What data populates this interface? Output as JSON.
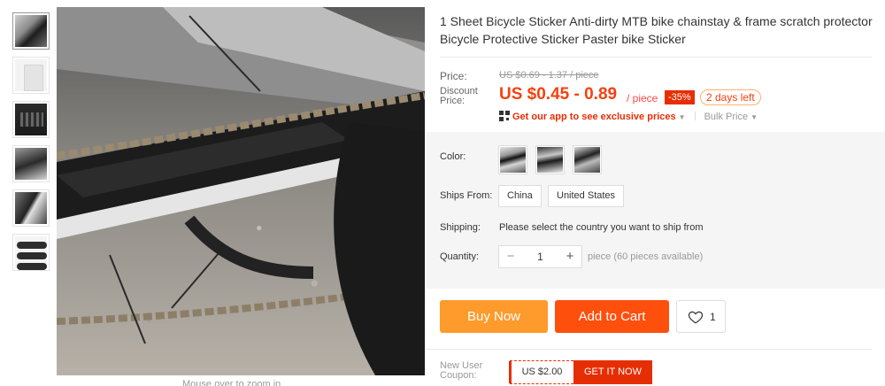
{
  "product": {
    "title": "1 Sheet Bicycle Sticker Anti-dirty MTB bike chainstay & frame scratch protector Bicycle Protective Sticker Paster bike Sticker"
  },
  "gallery": {
    "thumbnails": [
      "thumbnail-1",
      "thumbnail-2",
      "thumbnail-3",
      "thumbnail-4",
      "thumbnail-5",
      "thumbnail-6"
    ],
    "zoom_hint": "Mouse over to zoom in"
  },
  "price": {
    "label": "Price:",
    "original": "US $0.69 - 1.37 / piece",
    "discount_label": "Discount Price:",
    "current": "US $0.45 - 0.89",
    "unit": "/ piece",
    "discount_badge": "-35%",
    "time_left": "2 days left",
    "app_promo": "Get our app to see exclusive prices",
    "bulk_price": "Bulk Price"
  },
  "sku": {
    "color_label": "Color:",
    "ships_from_label": "Ships From:",
    "ships_from_options": [
      "China",
      "United States"
    ],
    "shipping_label": "Shipping:",
    "shipping_message": "Please select the country you want to ship from",
    "quantity_label": "Quantity:",
    "quantity_value": "1",
    "quantity_minus": "−",
    "quantity_plus": "+",
    "availability": "piece (60 pieces available)"
  },
  "actions": {
    "buy_now": "Buy Now",
    "add_to_cart": "Add to Cart",
    "wishlist_count": "1"
  },
  "coupon": {
    "label": "New User Coupon:",
    "amount": "US $2.00",
    "cta": "GET IT NOW"
  },
  "colors": {
    "accent_red": "#e62e04",
    "price_orange": "#f5410e",
    "buy_now_bg": "#ff9a2c",
    "add_to_cart_bg": "#ff4f0d"
  }
}
